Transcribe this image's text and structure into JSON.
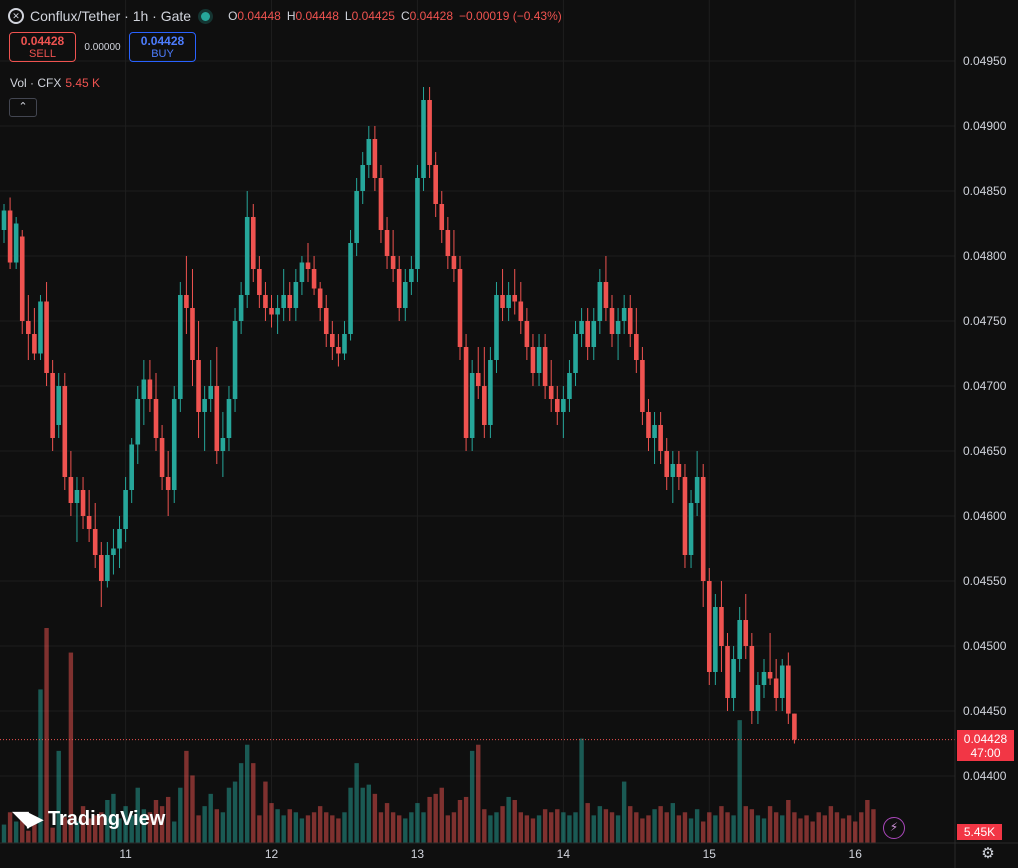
{
  "header": {
    "symbol": "Conflux/Tether · 1h · Gate",
    "ohlc": [
      {
        "k": "O",
        "v": "0.04448"
      },
      {
        "k": "H",
        "v": "0.04448"
      },
      {
        "k": "L",
        "v": "0.04425"
      },
      {
        "k": "C",
        "v": "0.04428"
      },
      {
        "k": "",
        "v": "−0.00019 (−0.43%)"
      }
    ]
  },
  "trade": {
    "sell_price": "0.04428",
    "sell_label": "SELL",
    "spread": "0.00000",
    "buy_price": "0.04428",
    "buy_label": "BUY"
  },
  "volume": {
    "label": "Vol · CFX",
    "value": "5.45 K"
  },
  "branding": "TradingView",
  "price_scale": {
    "last_price": "0.04428",
    "countdown": "47:00",
    "last_volume": "5.45K"
  },
  "colors": {
    "up": "#26a69a",
    "down": "#ef5350",
    "background": "#0f0f0f",
    "grid": "#1e1e1e"
  },
  "icons": {
    "logo": "conflux-logo-icon",
    "status": "market-open-dot-icon",
    "collapse": "chevron-up-icon",
    "flash": "lightning-icon",
    "settings": "gear-icon"
  },
  "chart_data": {
    "type": "candlestick",
    "interval": "1h",
    "y_ticks": [
      0.0495,
      0.049,
      0.0485,
      0.048,
      0.0475,
      0.047,
      0.0465,
      0.046,
      0.0455,
      0.045,
      0.0445,
      0.044
    ],
    "y_tick_labels": [
      "0.04950",
      "0.04900",
      "0.04850",
      "0.04800",
      "0.04750",
      "0.04700",
      "0.04650",
      "0.04600",
      "0.04550",
      "0.04500",
      "0.04450",
      "0.04400"
    ],
    "x_ticks": [
      {
        "label": "11",
        "index": 20
      },
      {
        "label": "12",
        "index": 44
      },
      {
        "label": "13",
        "index": 68
      },
      {
        "label": "14",
        "index": 92
      },
      {
        "label": "15",
        "index": 116
      },
      {
        "label": "16",
        "index": 140
      }
    ],
    "ylim": [
      0.04365,
      0.04995
    ],
    "candles": [
      [
        0.0482,
        0.0484,
        0.0481,
        0.04835
      ],
      [
        0.04835,
        0.04845,
        0.0479,
        0.04795
      ],
      [
        0.04795,
        0.0483,
        0.0479,
        0.04825
      ],
      [
        0.04815,
        0.0482,
        0.0474,
        0.0475
      ],
      [
        0.0475,
        0.0477,
        0.0472,
        0.0474
      ],
      [
        0.0474,
        0.0476,
        0.0472,
        0.04725
      ],
      [
        0.04725,
        0.0477,
        0.0472,
        0.04765
      ],
      [
        0.04765,
        0.0478,
        0.047,
        0.0471
      ],
      [
        0.0471,
        0.0472,
        0.0465,
        0.0466
      ],
      [
        0.0467,
        0.0471,
        0.0466,
        0.047
      ],
      [
        0.047,
        0.0471,
        0.0462,
        0.0463
      ],
      [
        0.0463,
        0.0465,
        0.046,
        0.0461
      ],
      [
        0.0461,
        0.0463,
        0.0458,
        0.0462
      ],
      [
        0.0462,
        0.0463,
        0.0459,
        0.046
      ],
      [
        0.046,
        0.0462,
        0.0458,
        0.0459
      ],
      [
        0.0459,
        0.0461,
        0.0456,
        0.0457
      ],
      [
        0.0457,
        0.0458,
        0.0453,
        0.0455
      ],
      [
        0.0455,
        0.0458,
        0.04545,
        0.0457
      ],
      [
        0.0457,
        0.0459,
        0.04555,
        0.04575
      ],
      [
        0.04575,
        0.046,
        0.0456,
        0.0459
      ],
      [
        0.0459,
        0.0463,
        0.0458,
        0.0462
      ],
      [
        0.0462,
        0.0466,
        0.0461,
        0.04655
      ],
      [
        0.04655,
        0.047,
        0.0464,
        0.0469
      ],
      [
        0.0469,
        0.0472,
        0.0467,
        0.04705
      ],
      [
        0.04705,
        0.0472,
        0.0468,
        0.0469
      ],
      [
        0.0469,
        0.0471,
        0.0465,
        0.0466
      ],
      [
        0.0466,
        0.0467,
        0.0462,
        0.0463
      ],
      [
        0.0463,
        0.0465,
        0.046,
        0.0462
      ],
      [
        0.0462,
        0.047,
        0.0461,
        0.0469
      ],
      [
        0.0469,
        0.0478,
        0.0468,
        0.0477
      ],
      [
        0.0477,
        0.048,
        0.0474,
        0.0476
      ],
      [
        0.0476,
        0.0479,
        0.047,
        0.0472
      ],
      [
        0.0472,
        0.0475,
        0.0466,
        0.0468
      ],
      [
        0.0468,
        0.047,
        0.0465,
        0.0469
      ],
      [
        0.0469,
        0.0472,
        0.0468,
        0.047
      ],
      [
        0.047,
        0.0473,
        0.0464,
        0.0465
      ],
      [
        0.0465,
        0.0468,
        0.0463,
        0.0466
      ],
      [
        0.0466,
        0.047,
        0.0465,
        0.0469
      ],
      [
        0.0469,
        0.0476,
        0.0468,
        0.0475
      ],
      [
        0.0475,
        0.0478,
        0.0474,
        0.0477
      ],
      [
        0.0477,
        0.0485,
        0.0476,
        0.0483
      ],
      [
        0.0483,
        0.0484,
        0.0478,
        0.0479
      ],
      [
        0.0479,
        0.048,
        0.0476,
        0.0477
      ],
      [
        0.0477,
        0.0478,
        0.0475,
        0.0476
      ],
      [
        0.0476,
        0.0477,
        0.04745,
        0.04755
      ],
      [
        0.04755,
        0.0477,
        0.0474,
        0.0476
      ],
      [
        0.0476,
        0.0479,
        0.0475,
        0.0477
      ],
      [
        0.0477,
        0.0478,
        0.0475,
        0.0476
      ],
      [
        0.0476,
        0.0479,
        0.0475,
        0.0478
      ],
      [
        0.0478,
        0.048,
        0.0477,
        0.04795
      ],
      [
        0.04795,
        0.0481,
        0.0478,
        0.0479
      ],
      [
        0.0479,
        0.048,
        0.0477,
        0.04775
      ],
      [
        0.04775,
        0.0478,
        0.0475,
        0.0476
      ],
      [
        0.0476,
        0.0477,
        0.0473,
        0.0474
      ],
      [
        0.0474,
        0.0475,
        0.0472,
        0.0473
      ],
      [
        0.0473,
        0.0474,
        0.04715,
        0.04725
      ],
      [
        0.04725,
        0.0475,
        0.0472,
        0.0474
      ],
      [
        0.0474,
        0.0482,
        0.04735,
        0.0481
      ],
      [
        0.0481,
        0.0486,
        0.048,
        0.0485
      ],
      [
        0.0485,
        0.0488,
        0.0484,
        0.0487
      ],
      [
        0.0487,
        0.049,
        0.0486,
        0.0489
      ],
      [
        0.0489,
        0.049,
        0.0485,
        0.0486
      ],
      [
        0.0486,
        0.0487,
        0.0481,
        0.0482
      ],
      [
        0.0482,
        0.0483,
        0.0479,
        0.048
      ],
      [
        0.048,
        0.0482,
        0.0478,
        0.0479
      ],
      [
        0.0479,
        0.048,
        0.0475,
        0.0476
      ],
      [
        0.0476,
        0.0479,
        0.0475,
        0.0478
      ],
      [
        0.0478,
        0.048,
        0.0477,
        0.0479
      ],
      [
        0.0479,
        0.0487,
        0.0478,
        0.0486
      ],
      [
        0.0486,
        0.0493,
        0.0485,
        0.0492
      ],
      [
        0.0492,
        0.0493,
        0.0486,
        0.0487
      ],
      [
        0.0487,
        0.0488,
        0.0483,
        0.0484
      ],
      [
        0.0484,
        0.0485,
        0.0481,
        0.0482
      ],
      [
        0.0482,
        0.0483,
        0.0479,
        0.048
      ],
      [
        0.048,
        0.0482,
        0.0478,
        0.0479
      ],
      [
        0.0479,
        0.048,
        0.0472,
        0.0473
      ],
      [
        0.0473,
        0.0474,
        0.0465,
        0.0466
      ],
      [
        0.0466,
        0.0472,
        0.0465,
        0.0471
      ],
      [
        0.0471,
        0.0473,
        0.0469,
        0.047
      ],
      [
        0.047,
        0.0473,
        0.0466,
        0.0467
      ],
      [
        0.0467,
        0.0473,
        0.0466,
        0.0472
      ],
      [
        0.0472,
        0.0478,
        0.0471,
        0.0477
      ],
      [
        0.0477,
        0.0479,
        0.0475,
        0.0476
      ],
      [
        0.0476,
        0.0478,
        0.0475,
        0.0477
      ],
      [
        0.0477,
        0.0479,
        0.04755,
        0.04765
      ],
      [
        0.04765,
        0.0478,
        0.0474,
        0.0475
      ],
      [
        0.0475,
        0.0476,
        0.0472,
        0.0473
      ],
      [
        0.0473,
        0.0474,
        0.047,
        0.0471
      ],
      [
        0.0471,
        0.0474,
        0.047,
        0.0473
      ],
      [
        0.0473,
        0.0474,
        0.0469,
        0.047
      ],
      [
        0.047,
        0.0472,
        0.0468,
        0.0469
      ],
      [
        0.0469,
        0.047,
        0.0467,
        0.0468
      ],
      [
        0.0468,
        0.047,
        0.0466,
        0.0469
      ],
      [
        0.0469,
        0.0472,
        0.0468,
        0.0471
      ],
      [
        0.0471,
        0.0475,
        0.047,
        0.0474
      ],
      [
        0.0474,
        0.0476,
        0.0473,
        0.0475
      ],
      [
        0.0475,
        0.0476,
        0.0472,
        0.0473
      ],
      [
        0.0473,
        0.0476,
        0.0472,
        0.0475
      ],
      [
        0.0475,
        0.0479,
        0.0474,
        0.0478
      ],
      [
        0.0478,
        0.048,
        0.0475,
        0.0476
      ],
      [
        0.0476,
        0.0477,
        0.0473,
        0.0474
      ],
      [
        0.0474,
        0.0476,
        0.0472,
        0.0475
      ],
      [
        0.0475,
        0.0477,
        0.0474,
        0.0476
      ],
      [
        0.0476,
        0.0477,
        0.0473,
        0.0474
      ],
      [
        0.0474,
        0.0476,
        0.0471,
        0.0472
      ],
      [
        0.0472,
        0.0473,
        0.0467,
        0.0468
      ],
      [
        0.0468,
        0.0469,
        0.0465,
        0.0466
      ],
      [
        0.0466,
        0.0468,
        0.0464,
        0.0467
      ],
      [
        0.0467,
        0.0468,
        0.0464,
        0.0465
      ],
      [
        0.0465,
        0.0466,
        0.0462,
        0.0463
      ],
      [
        0.0463,
        0.0465,
        0.0461,
        0.0464
      ],
      [
        0.0464,
        0.0465,
        0.0462,
        0.0463
      ],
      [
        0.0463,
        0.0464,
        0.0456,
        0.0457
      ],
      [
        0.0457,
        0.0462,
        0.0456,
        0.0461
      ],
      [
        0.0461,
        0.0465,
        0.046,
        0.0463
      ],
      [
        0.0463,
        0.0464,
        0.0453,
        0.0455
      ],
      [
        0.0455,
        0.0456,
        0.0447,
        0.0448
      ],
      [
        0.0448,
        0.0454,
        0.0447,
        0.0453
      ],
      [
        0.0453,
        0.0455,
        0.0448,
        0.045
      ],
      [
        0.045,
        0.0451,
        0.0445,
        0.0446
      ],
      [
        0.0446,
        0.045,
        0.0445,
        0.0449
      ],
      [
        0.0449,
        0.0453,
        0.0448,
        0.0452
      ],
      [
        0.0452,
        0.0454,
        0.0449,
        0.045
      ],
      [
        0.045,
        0.0451,
        0.0444,
        0.0445
      ],
      [
        0.0445,
        0.0448,
        0.0444,
        0.0447
      ],
      [
        0.0447,
        0.0449,
        0.0446,
        0.0448
      ],
      [
        0.0448,
        0.0451,
        0.0447,
        0.04475
      ],
      [
        0.04475,
        0.0449,
        0.0445,
        0.0446
      ],
      [
        0.0446,
        0.0449,
        0.0445,
        0.04485
      ],
      [
        0.04485,
        0.04495,
        0.0444,
        0.04448
      ],
      [
        0.04448,
        0.04448,
        0.04425,
        0.04428
      ]
    ],
    "volumes": [
      300,
      500,
      350,
      400,
      200,
      380,
      2500,
      3500,
      250,
      1500,
      420,
      3100,
      350,
      600,
      400,
      450,
      500,
      700,
      800,
      400,
      600,
      450,
      900,
      550,
      500,
      700,
      600,
      750,
      350,
      900,
      1500,
      1100,
      450,
      600,
      800,
      550,
      500,
      900,
      1000,
      1300,
      1600,
      1300,
      450,
      1000,
      650,
      550,
      450,
      550,
      500,
      400,
      450,
      500,
      600,
      500,
      450,
      400,
      500,
      900,
      1300,
      900,
      950,
      800,
      500,
      650,
      500,
      450,
      400,
      500,
      650,
      500,
      750,
      800,
      900,
      450,
      500,
      700,
      750,
      1500,
      1600,
      550,
      450,
      500,
      600,
      750,
      700,
      500,
      450,
      400,
      450,
      550,
      500,
      550,
      500,
      450,
      500,
      1700,
      650,
      450,
      600,
      550,
      500,
      450,
      1000,
      600,
      500,
      400,
      450,
      550,
      600,
      500,
      650,
      450,
      500,
      400,
      550,
      350,
      500,
      450,
      600,
      500,
      450,
      2000,
      600,
      550,
      450,
      400,
      600,
      500,
      450,
      700,
      500,
      400,
      450,
      350,
      500,
      450,
      600,
      500,
      400,
      450,
      350,
      500,
      700,
      550
    ]
  }
}
